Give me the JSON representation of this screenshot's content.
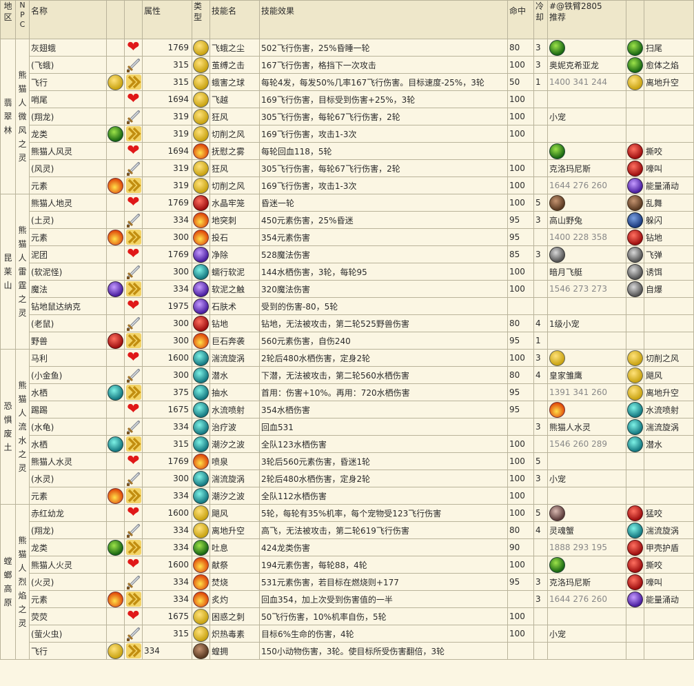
{
  "header": {
    "region": "地\n区",
    "npc": "N\nP\nC",
    "name": "名称",
    "attr": "属性",
    "type": "类\n型",
    "skill": "技能名",
    "effect": "技能效果",
    "hit": "命中",
    "cd": "冷\n却",
    "rec1": "#@铁臂2805",
    "rec2": "推荐"
  },
  "groups": [
    {
      "region": "翡\n翠\n林",
      "npc": "熊\n猫\n人\n微\n风\n之\n灵",
      "rows": [
        {
          "name": "灰翅蛾",
          "icon1": "",
          "icon2": "heart",
          "attr": "1769",
          "ticon": "i-fly",
          "skill": "飞蛾之尘",
          "effect": "502飞行伤害，25%昏睡一轮",
          "hit": "80",
          "cd": "3",
          "ricon": "i-drag",
          "rtext": "",
          "rcls": "",
          "sicon": "i-drag",
          "stext": "扫尾"
        },
        {
          "name": "(飞蛾)",
          "icon1": "",
          "icon2": "sword",
          "attr": "315",
          "ticon": "i-fly",
          "skill": "茧缚之击",
          "effect": "167飞行伤害，格挡下一次攻击",
          "hit": "100",
          "cd": "3",
          "ricon": "",
          "rtext": "奥妮克希亚龙",
          "rcls": "",
          "sicon": "i-drag",
          "stext": "愈体之焰"
        },
        {
          "name": "飞行",
          "icon1": "i-fly",
          "icon2": "chev",
          "attr": "315",
          "ticon": "i-fly",
          "skill": "蛾害之球",
          "effect": "每轮4发，每发50%几率167飞行伤害。目标速度-25%，3轮",
          "hit": "50",
          "cd": "1",
          "ricon": "",
          "rtext": "1400 341 244",
          "rcls": "grey",
          "sicon": "i-fly",
          "stext": "离地升空"
        },
        {
          "name": "哨尾",
          "icon1": "",
          "icon2": "heart",
          "attr": "1694",
          "ticon": "i-fly",
          "skill": "飞越",
          "effect": "169飞行伤害，目标受到伤害+25%，3轮",
          "hit": "100",
          "cd": "",
          "ricon": "",
          "rtext": "",
          "rcls": "",
          "sicon": "",
          "stext": ""
        },
        {
          "name": "(翔龙)",
          "icon1": "",
          "icon2": "sword",
          "attr": "319",
          "ticon": "i-fly",
          "skill": "狂风",
          "effect": "305飞行伤害，每轮67飞行伤害，2轮",
          "hit": "100",
          "cd": "",
          "ricon": "",
          "rtext": "小宠",
          "rcls": "",
          "sicon": "",
          "stext": ""
        },
        {
          "name": "龙类",
          "icon1": "i-drag",
          "icon2": "chev",
          "attr": "319",
          "ticon": "i-fly",
          "skill": "切削之风",
          "effect": "169飞行伤害，攻击1-3次",
          "hit": "100",
          "cd": "",
          "ricon": "",
          "rtext": "",
          "rcls": "",
          "sicon": "",
          "stext": ""
        },
        {
          "name": "熊猫人风灵",
          "icon1": "",
          "icon2": "heart",
          "attr": "1694",
          "ticon": "i-elem",
          "skill": "抚慰之雾",
          "effect": "每轮回血118，5轮",
          "hit": "",
          "cd": "",
          "ricon": "i-drag",
          "rtext": "",
          "rcls": "",
          "sicon": "i-beast",
          "stext": "撕咬"
        },
        {
          "name": "(风灵)",
          "icon1": "",
          "icon2": "sword",
          "attr": "319",
          "ticon": "i-fly",
          "skill": "狂风",
          "effect": "305飞行伤害，每轮67飞行伤害，2轮",
          "hit": "100",
          "cd": "",
          "ricon": "",
          "rtext": "克洛玛尼斯",
          "rcls": "",
          "sicon": "i-beast",
          "stext": "嚎叫"
        },
        {
          "name": "元素",
          "icon1": "i-elem",
          "icon2": "chev",
          "attr": "319",
          "ticon": "i-fly",
          "skill": "切削之风",
          "effect": "169飞行伤害，攻击1-3次",
          "hit": "100",
          "cd": "",
          "ricon": "",
          "rtext": "1644 276 260",
          "rcls": "grey",
          "sicon": "i-magic",
          "stext": "能量涌动"
        }
      ]
    },
    {
      "region": "昆\n莱\n山",
      "npc": "熊\n猫\n人\n雷\n霆\n之\n灵",
      "rows": [
        {
          "name": "熊猫人地灵",
          "icon1": "",
          "icon2": "heart",
          "attr": "1769",
          "ticon": "i-beast",
          "skill": "水晶牢笼",
          "effect": "昏迷一轮",
          "hit": "100",
          "cd": "5",
          "ricon": "i-crit",
          "rtext": "",
          "rcls": "",
          "sicon": "i-crit",
          "stext": "乱舞"
        },
        {
          "name": "(土灵)",
          "icon1": "",
          "icon2": "sword",
          "attr": "334",
          "ticon": "i-elem",
          "skill": "地突刺",
          "effect": "450元素伤害，25%昏迷",
          "hit": "95",
          "cd": "3",
          "ricon": "",
          "rtext": "高山野兔",
          "rcls": "",
          "sicon": "i-hum",
          "stext": "躲闪"
        },
        {
          "name": "元素",
          "icon1": "i-elem",
          "icon2": "chev",
          "attr": "300",
          "ticon": "i-elem",
          "skill": "投石",
          "effect": "354元素伤害",
          "hit": "95",
          "cd": "",
          "ricon": "",
          "rtext": "1400 228 358",
          "rcls": "grey",
          "sicon": "i-beast",
          "stext": "钻地"
        },
        {
          "name": "泥团",
          "icon1": "",
          "icon2": "heart",
          "attr": "1769",
          "ticon": "i-magic",
          "skill": "净除",
          "effect": "528魔法伤害",
          "hit": "85",
          "cd": "3",
          "ricon": "i-mech",
          "rtext": "",
          "rcls": "",
          "sicon": "i-mech",
          "stext": "飞弹"
        },
        {
          "name": "(软泥怪)",
          "icon1": "",
          "icon2": "sword",
          "attr": "300",
          "ticon": "i-water",
          "skill": "蠕行软泥",
          "effect": "144水栖伤害，3轮，每轮95",
          "hit": "100",
          "cd": "",
          "ricon": "",
          "rtext": "暗月飞艇",
          "rcls": "",
          "sicon": "i-mech",
          "stext": "诱饵"
        },
        {
          "name": "魔法",
          "icon1": "i-magic",
          "icon2": "chev",
          "attr": "334",
          "ticon": "i-magic",
          "skill": "软泥之触",
          "effect": "320魔法伤害",
          "hit": "100",
          "cd": "",
          "ricon": "",
          "rtext": "1546 273 273",
          "rcls": "grey",
          "sicon": "i-mech",
          "stext": "自爆"
        },
        {
          "name": "钻地鼠达纳克",
          "icon1": "",
          "icon2": "heart",
          "attr": "1975",
          "ticon": "i-magic",
          "skill": "石肤术",
          "effect": "受到的伤害-80，5轮",
          "hit": "",
          "cd": "",
          "ricon": "",
          "rtext": "",
          "rcls": "",
          "sicon": "",
          "stext": ""
        },
        {
          "name": "(老鼠)",
          "icon1": "",
          "icon2": "sword",
          "attr": "300",
          "ticon": "i-beast",
          "skill": "钻地",
          "effect": "钻地，无法被攻击，第二轮525野兽伤害",
          "hit": "80",
          "cd": "4",
          "ricon": "",
          "rtext": "1级小宠",
          "rcls": "",
          "sicon": "",
          "stext": ""
        },
        {
          "name": "野兽",
          "icon1": "i-beast",
          "icon2": "chev",
          "attr": "300",
          "ticon": "i-elem",
          "skill": "巨石奔袭",
          "effect": "560元素伤害，自伤240",
          "hit": "95",
          "cd": "1",
          "ricon": "",
          "rtext": "",
          "rcls": "",
          "sicon": "",
          "stext": ""
        }
      ]
    },
    {
      "region": "恐\n惧\n废\n土",
      "npc": "熊\n猫\n人\n流\n水\n之\n灵",
      "rows": [
        {
          "name": "马利",
          "icon1": "",
          "icon2": "heart",
          "attr": "1600",
          "ticon": "i-water",
          "skill": "湍流旋涡",
          "effect": "2轮后480水栖伤害，定身2轮",
          "hit": "100",
          "cd": "3",
          "ricon": "i-fly",
          "rtext": "",
          "rcls": "",
          "sicon": "i-fly",
          "stext": "切削之风"
        },
        {
          "name": "(小金鱼)",
          "icon1": "",
          "icon2": "sword",
          "attr": "300",
          "ticon": "i-water",
          "skill": "潜水",
          "effect": "下潜，无法被攻击，第二轮560水栖伤害",
          "hit": "80",
          "cd": "4",
          "ricon": "",
          "rtext": "皇家雏鹰",
          "rcls": "",
          "sicon": "i-fly",
          "stext": "飓风"
        },
        {
          "name": "水栖",
          "icon1": "i-water",
          "icon2": "chev",
          "attr": "375",
          "ticon": "i-water",
          "skill": "抽水",
          "effect": "首用：伤害+10%。再用：720水栖伤害",
          "hit": "95",
          "cd": "",
          "ricon": "",
          "rtext": "1391 341 260",
          "rcls": "grey",
          "sicon": "i-fly",
          "stext": "离地升空"
        },
        {
          "name": "踢踢",
          "icon1": "",
          "icon2": "heart",
          "attr": "1675",
          "ticon": "i-water",
          "skill": "水流喷射",
          "effect": "354水栖伤害",
          "hit": "95",
          "cd": "",
          "ricon": "i-elem",
          "rtext": "",
          "rcls": "",
          "sicon": "i-water",
          "stext": "水流喷射"
        },
        {
          "name": "(水龟)",
          "icon1": "",
          "icon2": "sword",
          "attr": "334",
          "ticon": "i-water",
          "skill": "治疗波",
          "effect": "回血531",
          "hit": "",
          "cd": "3",
          "ricon": "",
          "rtext": "熊猫人水灵",
          "rcls": "",
          "sicon": "i-water",
          "stext": "湍流旋涡"
        },
        {
          "name": "水栖",
          "icon1": "i-water",
          "icon2": "chev",
          "attr": "315",
          "ticon": "i-water",
          "skill": "潮汐之波",
          "effect": "全队123水栖伤害",
          "hit": "100",
          "cd": "",
          "ricon": "",
          "rtext": "1546 260 289",
          "rcls": "grey",
          "sicon": "i-water",
          "stext": "潜水"
        },
        {
          "name": "熊猫人水灵",
          "icon1": "",
          "icon2": "heart",
          "attr": "1769",
          "ticon": "i-elem",
          "skill": "喷泉",
          "effect": "3轮后560元素伤害，昏迷1轮",
          "hit": "100",
          "cd": "5",
          "ricon": "",
          "rtext": "",
          "rcls": "",
          "sicon": "",
          "stext": ""
        },
        {
          "name": "(水灵)",
          "icon1": "",
          "icon2": "sword",
          "attr": "300",
          "ticon": "i-water",
          "skill": "湍流旋涡",
          "effect": "2轮后480水栖伤害，定身2轮",
          "hit": "100",
          "cd": "3",
          "ricon": "",
          "rtext": "小宠",
          "rcls": "",
          "sicon": "",
          "stext": ""
        },
        {
          "name": "元素",
          "icon1": "i-elem",
          "icon2": "chev",
          "attr": "334",
          "ticon": "i-water",
          "skill": "潮汐之波",
          "effect": "全队112水栖伤害",
          "hit": "100",
          "cd": "",
          "ricon": "",
          "rtext": "",
          "rcls": "",
          "sicon": "",
          "stext": ""
        }
      ]
    },
    {
      "region": "螳\n螂\n高\n原",
      "npc": "熊\n猫\n人\n烈\n焰\n之\n灵",
      "rows": [
        {
          "name": "赤红幼龙",
          "icon1": "",
          "icon2": "heart",
          "attr": "1600",
          "ticon": "i-fly",
          "skill": "飓风",
          "effect": "5轮，每轮有35%机率，每个宠物受123飞行伤害",
          "hit": "100",
          "cd": "5",
          "ricon": "i-undead",
          "rtext": "",
          "rcls": "",
          "sicon": "i-beast",
          "stext": "猛咬"
        },
        {
          "name": "(翔龙)",
          "icon1": "",
          "icon2": "sword",
          "attr": "334",
          "ticon": "i-fly",
          "skill": "离地升空",
          "effect": "高飞，无法被攻击，第二轮619飞行伤害",
          "hit": "80",
          "cd": "4",
          "ricon": "",
          "rtext": "灵魂蟹",
          "rcls": "",
          "sicon": "i-water",
          "stext": "湍流旋涡"
        },
        {
          "name": "龙类",
          "icon1": "i-drag",
          "icon2": "chev",
          "attr": "334",
          "ticon": "i-drag",
          "skill": "吐息",
          "effect": "424龙类伤害",
          "hit": "90",
          "cd": "",
          "ricon": "",
          "rtext": "1888 293 195",
          "rcls": "grey",
          "sicon": "i-beast",
          "stext": "甲壳护盾"
        },
        {
          "name": "熊猫人火灵",
          "icon1": "",
          "icon2": "heart",
          "attr": "1600",
          "ticon": "i-elem",
          "skill": "献祭",
          "effect": "194元素伤害，每轮88，4轮",
          "hit": "100",
          "cd": "",
          "ricon": "i-drag",
          "rtext": "",
          "rcls": "",
          "sicon": "i-beast",
          "stext": "撕咬"
        },
        {
          "name": "(火灵)",
          "icon1": "",
          "icon2": "sword",
          "attr": "334",
          "ticon": "i-elem",
          "skill": "焚烧",
          "effect": "531元素伤害，若目标在燃烧则+177",
          "hit": "95",
          "cd": "3",
          "ricon": "",
          "rtext": "克洛玛尼斯",
          "rcls": "",
          "sicon": "i-beast",
          "stext": "嚎叫"
        },
        {
          "name": "元素",
          "icon1": "i-elem",
          "icon2": "chev",
          "attr": "334",
          "ticon": "i-elem",
          "skill": "炙灼",
          "effect": "回血354，加上次受到伤害值的一半",
          "hit": "",
          "cd": "3",
          "ricon": "",
          "rtext": "1644 276 260",
          "rcls": "grey",
          "sicon": "i-magic",
          "stext": "能量涌动"
        },
        {
          "name": "荧荧",
          "icon1": "",
          "icon2": "heart",
          "attr": "1675",
          "ticon": "i-fly",
          "skill": "困惑之刺",
          "effect": "50飞行伤害，10%机率自伤，5轮",
          "hit": "100",
          "cd": "",
          "ricon": "",
          "rtext": "",
          "rcls": "",
          "sicon": "",
          "stext": ""
        },
        {
          "name": "(萤火虫)",
          "icon1": "",
          "icon2": "sword",
          "attr": "315",
          "ticon": "i-fly",
          "skill": "炽热毒素",
          "effect": "目标6%生命的伤害，4轮",
          "hit": "100",
          "cd": "",
          "ricon": "",
          "rtext": "小宠",
          "rcls": "",
          "sicon": "",
          "stext": ""
        },
        {
          "name": "飞行",
          "icon1": "i-fly",
          "icon2": "chev",
          "attr": "334",
          "ticon": "i-crit",
          "skill": "蝗拥",
          "effect": "150小动物伤害，3轮。使目标所受伤害翻倍，3轮",
          "hit": "",
          "cd": "",
          "ricon": "",
          "rtext": "",
          "rcls": "",
          "sicon": "",
          "stext": ""
        }
      ]
    }
  ]
}
